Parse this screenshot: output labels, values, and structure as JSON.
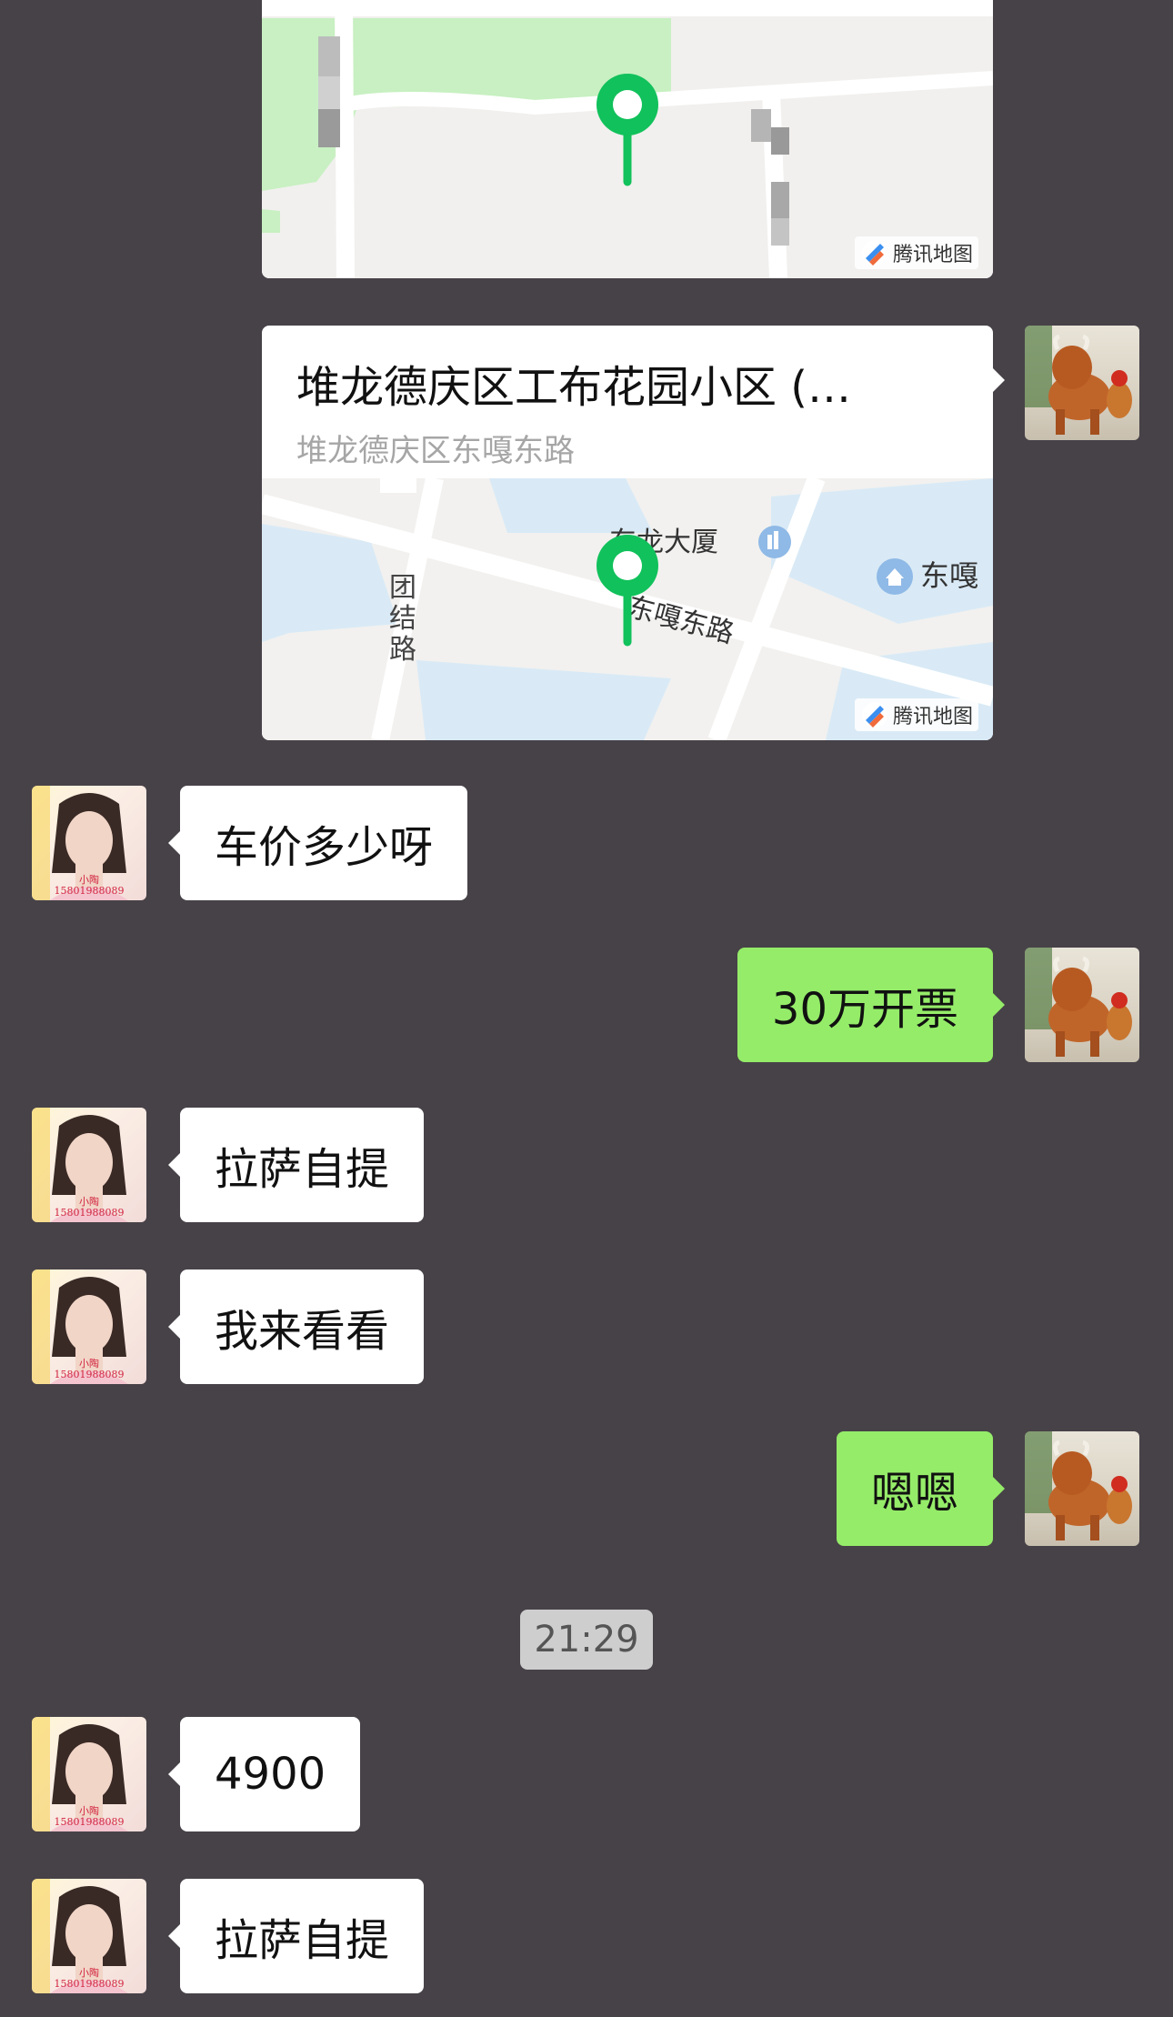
{
  "map_top": {
    "watermark": "腾讯地图"
  },
  "location_card": {
    "title": "堆龙德庆区工布花园小区 (…",
    "subtitle": "堆龙德庆区东嘎东路",
    "map_labels": {
      "building": "东龙大厦",
      "road_main": "东嘎东路",
      "road_side": "团结路",
      "poi": "东嘎"
    },
    "watermark": "腾讯地图"
  },
  "avatar_caption": {
    "name": "小陶",
    "phone": "15801988089"
  },
  "messages": [
    {
      "text": "车价多少呀"
    },
    {
      "text": "30万开票"
    },
    {
      "text": "拉萨自提"
    },
    {
      "text": "我来看看"
    },
    {
      "text": "嗯嗯"
    },
    {
      "text": "4900"
    },
    {
      "text": "拉萨自提"
    }
  ],
  "timestamp": "21:29",
  "colors": {
    "background": "#474248",
    "incoming": "#ffffff",
    "outgoing": "#95ec69",
    "pin": "#11c15b"
  }
}
